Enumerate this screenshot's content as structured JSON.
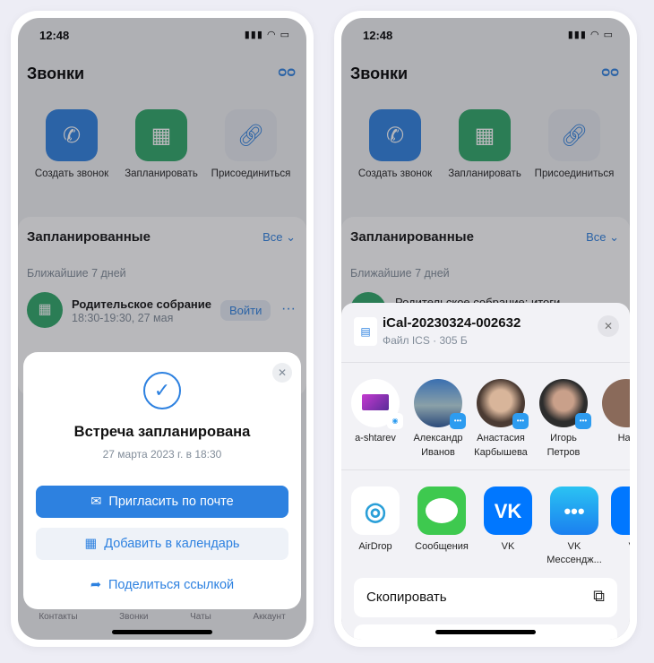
{
  "status": {
    "time": "12:48",
    "icons": "▮▮▮ ◠ ▭"
  },
  "calls": {
    "title": "Звонки",
    "actions": [
      {
        "label": "Создать звонок",
        "icon": "phone-plus-icon",
        "color": "#2d81e0"
      },
      {
        "label": "Запланировать",
        "icon": "calendar-plus-icon",
        "color": "#2da867"
      },
      {
        "label": "Присоединиться",
        "icon": "link-icon",
        "color": "#e8ebf0"
      }
    ],
    "scheduled": {
      "title": "Запланированные",
      "all": "Все",
      "range": "Ближайшие 7 дней",
      "event_title": "Родительское собрание",
      "event_time": "18:30-19:30, 27 мая",
      "join": "Войти",
      "event_title_right": "Родительское собрание: итоги"
    },
    "tabs": [
      "Контакты",
      "Звонки",
      "Чаты",
      "Аккаунт"
    ]
  },
  "modal": {
    "title": "Встреча запланирована",
    "subtitle": "27 марта 2023 г. в 18:30",
    "invite": "Пригласить по почте",
    "calendar": "Добавить в календарь",
    "share": "Поделиться ссылкой"
  },
  "sheet": {
    "file_name": "iCal-20230324-002632",
    "file_info": "Файл ICS · 305 Б",
    "people": [
      {
        "l1": "a-shtarev",
        "l2": ""
      },
      {
        "l1": "Александр",
        "l2": "Иванов"
      },
      {
        "l1": "Анастасия",
        "l2": "Карбышева"
      },
      {
        "l1": "Игорь",
        "l2": "Петров"
      },
      {
        "l1": "Нат",
        "l2": ""
      }
    ],
    "apps": [
      {
        "l1": "AirDrop",
        "l2": ""
      },
      {
        "l1": "Сообщения",
        "l2": ""
      },
      {
        "l1": "VK",
        "l2": ""
      },
      {
        "l1": "VK",
        "l2": "Мессендж..."
      },
      {
        "l1": "VK",
        "l2": ""
      }
    ],
    "copy": "Скопировать"
  },
  "colors": {
    "accent": "#2d81e0",
    "green": "#2da867"
  }
}
